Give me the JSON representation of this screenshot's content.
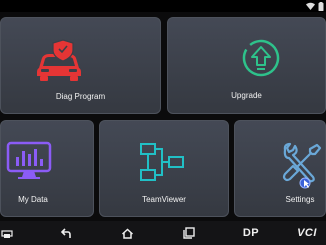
{
  "tiles": {
    "diag": {
      "label": "Diag Program",
      "icon": "car-shield-icon",
      "accent": "#e53535"
    },
    "upgrade": {
      "label": "Upgrade",
      "icon": "upgrade-arrow-icon",
      "accent": "#2ec28b"
    },
    "mydata": {
      "label": "My Data",
      "icon": "data-monitor-icon",
      "accent": "#8b5cf6"
    },
    "teamviewer": {
      "label": "TeamViewer",
      "icon": "network-diagram-icon",
      "accent": "#21c0c6"
    },
    "settings": {
      "label": "Settings",
      "icon": "wrench-screwdriver-icon",
      "accent": "#6aa8d8"
    }
  },
  "navbar": {
    "dp_label": "DP",
    "vci_label": "VCI"
  }
}
